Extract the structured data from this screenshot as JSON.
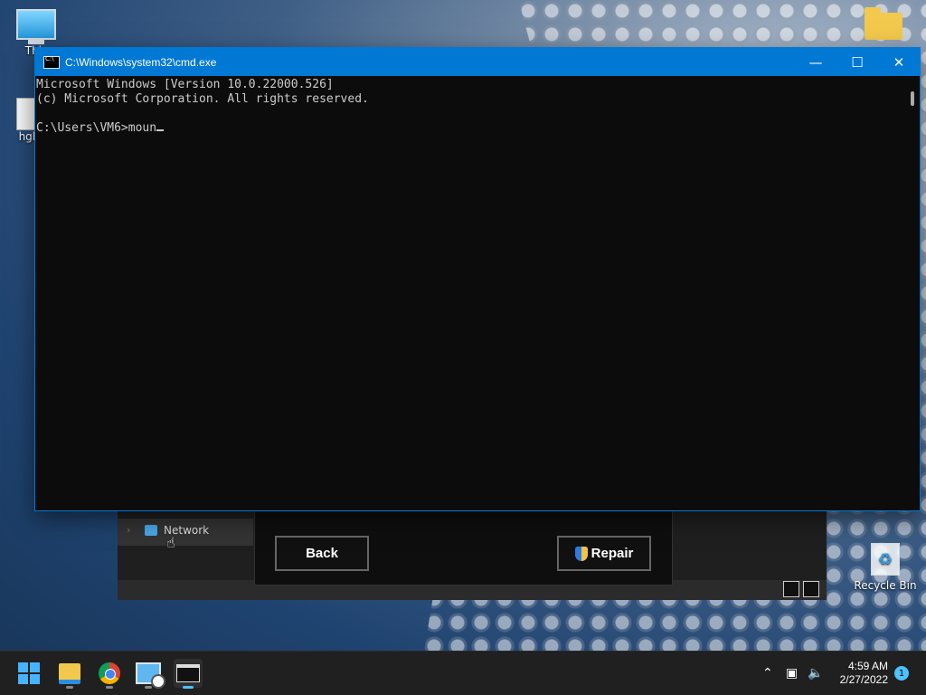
{
  "desktop": {
    "icons": [
      {
        "label": "This",
        "kind": "this-pc"
      },
      {
        "label": "hgh",
        "kind": "document"
      },
      {
        "label": "",
        "kind": "folder"
      }
    ],
    "recycle_bin": "Recycle Bin"
  },
  "cmd": {
    "title": "C:\\Windows\\system32\\cmd.exe",
    "line1": "Microsoft Windows [Version 10.0.22000.526]",
    "line2": "(c) Microsoft Corporation. All rights reserved.",
    "prompt": "C:\\Users\\VM6>moun",
    "buttons": {
      "minimize": "—",
      "maximize": "☐",
      "close": "✕"
    }
  },
  "explorer": {
    "nav_item": "Network"
  },
  "dialog": {
    "back_label": "Back",
    "repair_label": "Repair"
  },
  "taskbar": {
    "apps": [
      {
        "name": "Start",
        "icon": "windows-icon"
      },
      {
        "name": "File Explorer",
        "icon": "folder-icon"
      },
      {
        "name": "Google Chrome",
        "icon": "chrome-icon"
      },
      {
        "name": "Remote Desktop",
        "icon": "remote-desktop-icon"
      },
      {
        "name": "Command Prompt",
        "icon": "terminal-icon",
        "active": true
      }
    ],
    "time": "4:59 AM",
    "date": "2/27/2022",
    "notifications": "1"
  },
  "colors": {
    "accent": "#0078d4",
    "console_bg": "#0c0c0c",
    "console_text": "#cccccc"
  }
}
